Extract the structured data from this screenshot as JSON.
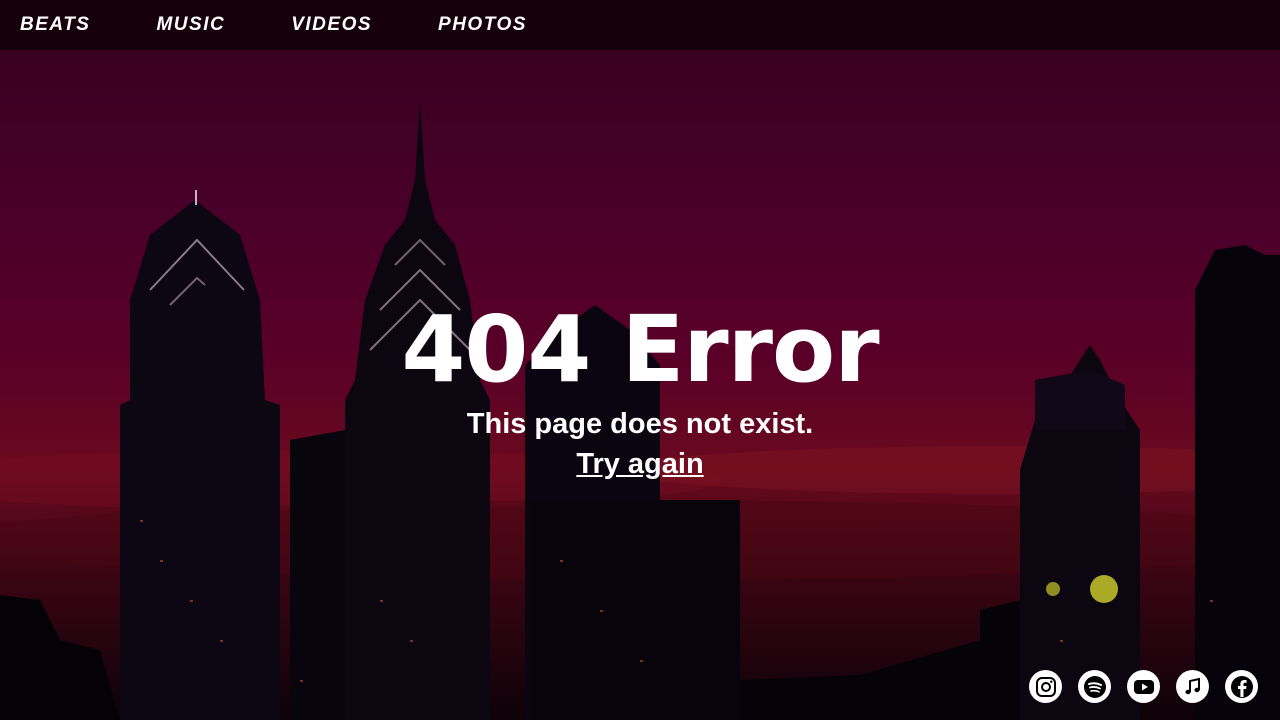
{
  "nav": {
    "items": [
      {
        "label": "BEATS"
      },
      {
        "label": "MUSIC"
      },
      {
        "label": "VIDEOS"
      },
      {
        "label": "PHOTOS"
      }
    ]
  },
  "error": {
    "title": "404 Error",
    "message": "This page does not exist.",
    "link": "Try again"
  },
  "social": {
    "icons": [
      "instagram-icon",
      "spotify-icon",
      "youtube-icon",
      "apple-music-icon",
      "facebook-icon"
    ]
  },
  "colors": {
    "nav_background": "#12000a",
    "sky_top": "#34001f",
    "sky_horizon": "#6a0a1e",
    "text": "#ffffff"
  }
}
